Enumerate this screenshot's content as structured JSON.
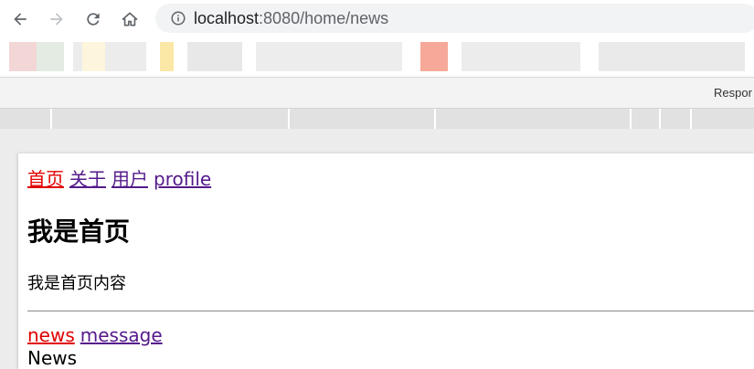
{
  "browser": {
    "address": {
      "host": "localhost",
      "rest": ":8080/home/news"
    },
    "devtools_label": "Respor"
  },
  "page": {
    "nav_links": [
      {
        "label": "首页",
        "active": true
      },
      {
        "label": "关于",
        "active": false
      },
      {
        "label": "用户",
        "active": false
      },
      {
        "label": "profile",
        "active": false
      }
    ],
    "heading": "我是首页",
    "paragraph": "我是首页内容",
    "sub_links": [
      {
        "label": "news",
        "active": true
      },
      {
        "label": "message",
        "active": false
      }
    ],
    "sub_content": "News"
  },
  "colors": {
    "active_link": "#e00000",
    "visited_link": "#551a8b"
  },
  "icons": [
    "back-arrow-icon",
    "forward-arrow-icon",
    "reload-icon",
    "home-icon",
    "info-icon"
  ]
}
